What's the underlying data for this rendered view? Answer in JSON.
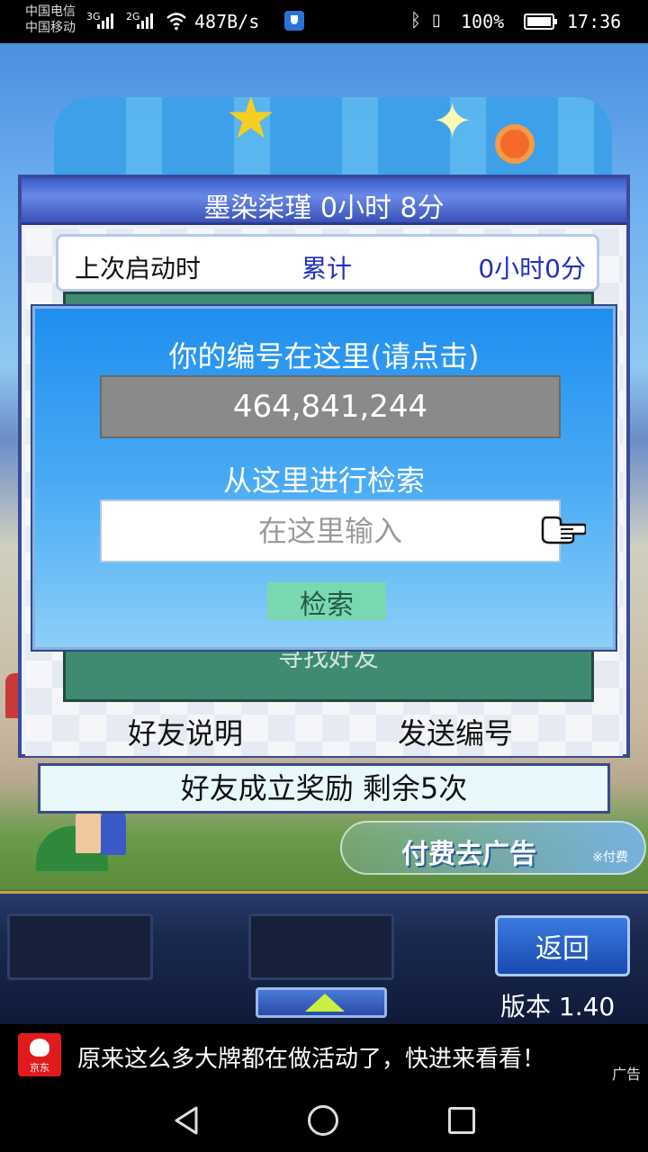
{
  "status_bar": {
    "carrier_1": "中国电信",
    "carrier_2": "中国移动",
    "signal_1": "3G",
    "signal_2": "2G",
    "net_speed": "487B/s",
    "battery": "100%",
    "time": "17:36"
  },
  "dialog": {
    "title": "墨染柒瑾  0小时 8分",
    "last_launch_label": "上次启动时",
    "total_label": "累计",
    "total_time": "0小时0分",
    "find_friend": "寻找好友",
    "friend_help": "好友说明",
    "send_id": "发送编号"
  },
  "popup": {
    "title": "你的编号在这里(请点击)",
    "player_id": "464,841,244",
    "search_title": "从这里进行检索",
    "search_placeholder": "在这里输入",
    "search_button": "检索"
  },
  "reward_bar": "好友成立奖励  剩余5次",
  "adfree": {
    "label": "付费去广告",
    "note": "※付费"
  },
  "hud": {
    "back_button": "返回",
    "version": "版本 1.40"
  },
  "ad_banner": {
    "logo_text": "京东",
    "text": "原来这么多大牌都在做活动了，快进来看看！",
    "label": "广告"
  },
  "colors": {
    "dialog_header": "#3a5ac8",
    "popup_blue": "#1f8ef0",
    "search_button": "#7ad8b0",
    "green_panel": "#3f8a72",
    "link_blue": "#2030c0"
  },
  "icons": {
    "status": [
      "wifi-icon",
      "shield-icon",
      "bluetooth-icon",
      "vibrate-icon",
      "battery-icon"
    ],
    "pointer": "pointing-hand-icon",
    "nav": [
      "back-triangle-icon",
      "home-circle-icon",
      "recent-square-icon"
    ]
  }
}
